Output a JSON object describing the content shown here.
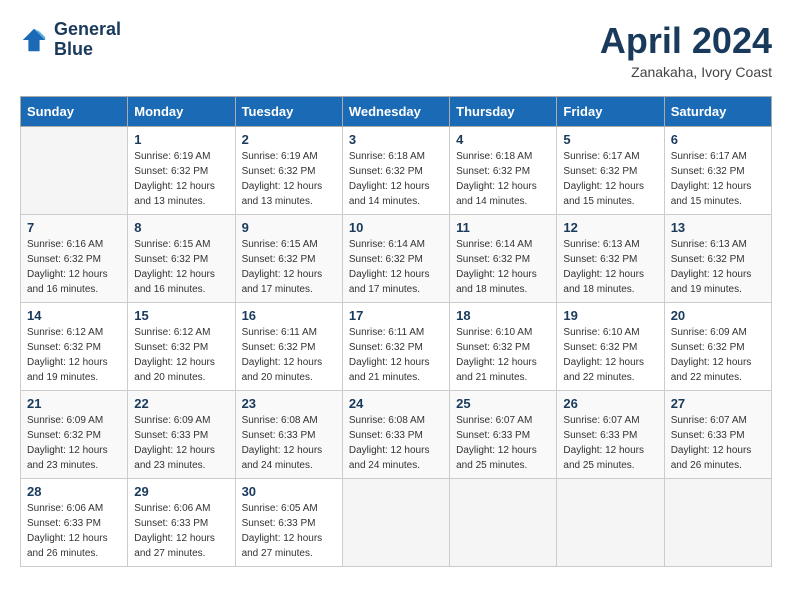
{
  "header": {
    "logo_line1": "General",
    "logo_line2": "Blue",
    "month_title": "April 2024",
    "subtitle": "Zanakaha, Ivory Coast"
  },
  "days_of_week": [
    "Sunday",
    "Monday",
    "Tuesday",
    "Wednesday",
    "Thursday",
    "Friday",
    "Saturday"
  ],
  "weeks": [
    [
      {
        "num": "",
        "sunrise": "",
        "sunset": "",
        "daylight": "",
        "empty": true
      },
      {
        "num": "1",
        "sunrise": "Sunrise: 6:19 AM",
        "sunset": "Sunset: 6:32 PM",
        "daylight": "Daylight: 12 hours and 13 minutes."
      },
      {
        "num": "2",
        "sunrise": "Sunrise: 6:19 AM",
        "sunset": "Sunset: 6:32 PM",
        "daylight": "Daylight: 12 hours and 13 minutes."
      },
      {
        "num": "3",
        "sunrise": "Sunrise: 6:18 AM",
        "sunset": "Sunset: 6:32 PM",
        "daylight": "Daylight: 12 hours and 14 minutes."
      },
      {
        "num": "4",
        "sunrise": "Sunrise: 6:18 AM",
        "sunset": "Sunset: 6:32 PM",
        "daylight": "Daylight: 12 hours and 14 minutes."
      },
      {
        "num": "5",
        "sunrise": "Sunrise: 6:17 AM",
        "sunset": "Sunset: 6:32 PM",
        "daylight": "Daylight: 12 hours and 15 minutes."
      },
      {
        "num": "6",
        "sunrise": "Sunrise: 6:17 AM",
        "sunset": "Sunset: 6:32 PM",
        "daylight": "Daylight: 12 hours and 15 minutes."
      }
    ],
    [
      {
        "num": "7",
        "sunrise": "Sunrise: 6:16 AM",
        "sunset": "Sunset: 6:32 PM",
        "daylight": "Daylight: 12 hours and 16 minutes."
      },
      {
        "num": "8",
        "sunrise": "Sunrise: 6:15 AM",
        "sunset": "Sunset: 6:32 PM",
        "daylight": "Daylight: 12 hours and 16 minutes."
      },
      {
        "num": "9",
        "sunrise": "Sunrise: 6:15 AM",
        "sunset": "Sunset: 6:32 PM",
        "daylight": "Daylight: 12 hours and 17 minutes."
      },
      {
        "num": "10",
        "sunrise": "Sunrise: 6:14 AM",
        "sunset": "Sunset: 6:32 PM",
        "daylight": "Daylight: 12 hours and 17 minutes."
      },
      {
        "num": "11",
        "sunrise": "Sunrise: 6:14 AM",
        "sunset": "Sunset: 6:32 PM",
        "daylight": "Daylight: 12 hours and 18 minutes."
      },
      {
        "num": "12",
        "sunrise": "Sunrise: 6:13 AM",
        "sunset": "Sunset: 6:32 PM",
        "daylight": "Daylight: 12 hours and 18 minutes."
      },
      {
        "num": "13",
        "sunrise": "Sunrise: 6:13 AM",
        "sunset": "Sunset: 6:32 PM",
        "daylight": "Daylight: 12 hours and 19 minutes."
      }
    ],
    [
      {
        "num": "14",
        "sunrise": "Sunrise: 6:12 AM",
        "sunset": "Sunset: 6:32 PM",
        "daylight": "Daylight: 12 hours and 19 minutes."
      },
      {
        "num": "15",
        "sunrise": "Sunrise: 6:12 AM",
        "sunset": "Sunset: 6:32 PM",
        "daylight": "Daylight: 12 hours and 20 minutes."
      },
      {
        "num": "16",
        "sunrise": "Sunrise: 6:11 AM",
        "sunset": "Sunset: 6:32 PM",
        "daylight": "Daylight: 12 hours and 20 minutes."
      },
      {
        "num": "17",
        "sunrise": "Sunrise: 6:11 AM",
        "sunset": "Sunset: 6:32 PM",
        "daylight": "Daylight: 12 hours and 21 minutes."
      },
      {
        "num": "18",
        "sunrise": "Sunrise: 6:10 AM",
        "sunset": "Sunset: 6:32 PM",
        "daylight": "Daylight: 12 hours and 21 minutes."
      },
      {
        "num": "19",
        "sunrise": "Sunrise: 6:10 AM",
        "sunset": "Sunset: 6:32 PM",
        "daylight": "Daylight: 12 hours and 22 minutes."
      },
      {
        "num": "20",
        "sunrise": "Sunrise: 6:09 AM",
        "sunset": "Sunset: 6:32 PM",
        "daylight": "Daylight: 12 hours and 22 minutes."
      }
    ],
    [
      {
        "num": "21",
        "sunrise": "Sunrise: 6:09 AM",
        "sunset": "Sunset: 6:32 PM",
        "daylight": "Daylight: 12 hours and 23 minutes."
      },
      {
        "num": "22",
        "sunrise": "Sunrise: 6:09 AM",
        "sunset": "Sunset: 6:33 PM",
        "daylight": "Daylight: 12 hours and 23 minutes."
      },
      {
        "num": "23",
        "sunrise": "Sunrise: 6:08 AM",
        "sunset": "Sunset: 6:33 PM",
        "daylight": "Daylight: 12 hours and 24 minutes."
      },
      {
        "num": "24",
        "sunrise": "Sunrise: 6:08 AM",
        "sunset": "Sunset: 6:33 PM",
        "daylight": "Daylight: 12 hours and 24 minutes."
      },
      {
        "num": "25",
        "sunrise": "Sunrise: 6:07 AM",
        "sunset": "Sunset: 6:33 PM",
        "daylight": "Daylight: 12 hours and 25 minutes."
      },
      {
        "num": "26",
        "sunrise": "Sunrise: 6:07 AM",
        "sunset": "Sunset: 6:33 PM",
        "daylight": "Daylight: 12 hours and 25 minutes."
      },
      {
        "num": "27",
        "sunrise": "Sunrise: 6:07 AM",
        "sunset": "Sunset: 6:33 PM",
        "daylight": "Daylight: 12 hours and 26 minutes."
      }
    ],
    [
      {
        "num": "28",
        "sunrise": "Sunrise: 6:06 AM",
        "sunset": "Sunset: 6:33 PM",
        "daylight": "Daylight: 12 hours and 26 minutes."
      },
      {
        "num": "29",
        "sunrise": "Sunrise: 6:06 AM",
        "sunset": "Sunset: 6:33 PM",
        "daylight": "Daylight: 12 hours and 27 minutes."
      },
      {
        "num": "30",
        "sunrise": "Sunrise: 6:05 AM",
        "sunset": "Sunset: 6:33 PM",
        "daylight": "Daylight: 12 hours and 27 minutes."
      },
      {
        "num": "",
        "sunrise": "",
        "sunset": "",
        "daylight": "",
        "empty": true
      },
      {
        "num": "",
        "sunrise": "",
        "sunset": "",
        "daylight": "",
        "empty": true
      },
      {
        "num": "",
        "sunrise": "",
        "sunset": "",
        "daylight": "",
        "empty": true
      },
      {
        "num": "",
        "sunrise": "",
        "sunset": "",
        "daylight": "",
        "empty": true
      }
    ]
  ]
}
